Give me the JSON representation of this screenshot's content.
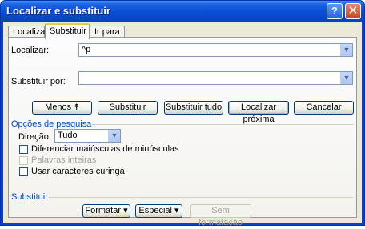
{
  "window": {
    "title": "Localizar e substituir",
    "help_glyph": "?",
    "close_glyph": "✕"
  },
  "tabs": [
    {
      "label": "Localizar"
    },
    {
      "label": "Substituir"
    },
    {
      "label": "Ir para"
    }
  ],
  "find": {
    "label": "Localizar:",
    "value": "^p"
  },
  "replace": {
    "label": "Substituir por:",
    "value": ""
  },
  "buttons": {
    "less": "Menos  ⯭",
    "replace": "Substituir",
    "replace_all": "Substituir tudo",
    "find_next": "Localizar próxima",
    "cancel": "Cancelar"
  },
  "search_options": {
    "title": "Opções de pesquisa",
    "direction_label": "Direção:",
    "direction_value": "Tudo",
    "checkboxes": [
      {
        "label": "Diferenciar maiúsculas de minúsculas",
        "enabled": true,
        "checked": false
      },
      {
        "label": "Palavras inteiras",
        "enabled": false,
        "checked": false
      },
      {
        "label": "Usar caracteres curinga",
        "enabled": true,
        "checked": false
      }
    ]
  },
  "replace_section": {
    "title": "Substituir",
    "format_button": "Formatar ▾",
    "special_button": "Especial ▾",
    "no_format_button": "Sem formatação"
  },
  "colors": {
    "titlebar": "#0b4fd6",
    "dialog_bg": "#ece9d8",
    "section_title": "#0046d5",
    "disabled_text": "#a3a29a"
  }
}
